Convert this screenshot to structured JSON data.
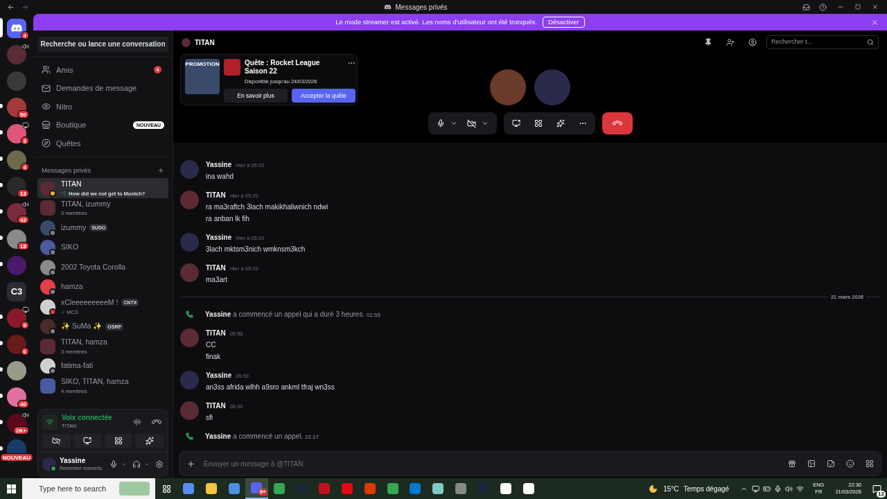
{
  "titlebar": {
    "title": "Messages privés"
  },
  "banner": {
    "text": "Le mode streamer est activé. Les noms d'utilisateur ont été tronqués.",
    "button": "Désactiver"
  },
  "servers": [
    {
      "kind": "home",
      "badge": "4",
      "unread": false,
      "selected": true,
      "speaker": false,
      "monitor": false
    },
    {
      "kind": "avatar",
      "color": "#5a2a35",
      "unread": false,
      "selected": false,
      "speaker": true,
      "monitor": false
    },
    {
      "kind": "avatar",
      "color": "#3a3a3a",
      "unread": false,
      "selected": false,
      "speaker": false,
      "monitor": false
    },
    {
      "kind": "avatar",
      "color": "#a33a3a",
      "badge": "50",
      "unread": true,
      "selected": false,
      "speaker": false,
      "monitor": false
    },
    {
      "kind": "avatar",
      "color": "#e0567a",
      "badge": "3",
      "unread": true,
      "selected": false,
      "speaker": false,
      "monitor": true
    },
    {
      "kind": "avatar",
      "color": "#6b6b4a",
      "badge": "4",
      "unread": true,
      "selected": false,
      "speaker": false,
      "monitor": false
    },
    {
      "kind": "avatar",
      "color": "#2a2a2a",
      "badge": "13",
      "unread": true,
      "selected": false,
      "speaker": false,
      "monitor": false
    },
    {
      "kind": "avatar",
      "color": "#7a2a3a",
      "badge": "42",
      "unread": true,
      "selected": false,
      "speaker": true,
      "monitor": false
    },
    {
      "kind": "avatar",
      "color": "#8a8a8a",
      "badge": "15",
      "unread": true,
      "selected": false,
      "speaker": false,
      "monitor": false
    },
    {
      "kind": "avatar",
      "color": "#4a1a6a",
      "unread": true,
      "selected": false,
      "speaker": false,
      "monitor": false
    },
    {
      "kind": "text",
      "label": "C3",
      "unread": false,
      "selected": false,
      "speaker": false,
      "monitor": false
    },
    {
      "kind": "avatar",
      "color": "#8a1a2a",
      "badge": "9",
      "unread": true,
      "selected": false,
      "speaker": false,
      "monitor": true
    },
    {
      "kind": "avatar",
      "color": "#6a1a1a",
      "badge": "6",
      "unread": true,
      "selected": false,
      "speaker": false,
      "monitor": false
    },
    {
      "kind": "avatar",
      "color": "#9a9a8a",
      "unread": true,
      "selected": false,
      "speaker": false,
      "monitor": false
    },
    {
      "kind": "avatar",
      "color": "#e070a0",
      "badge": "40",
      "unread": true,
      "selected": false,
      "speaker": false,
      "monitor": false
    },
    {
      "kind": "avatar",
      "color": "#5a0a1a",
      "badge": "2K+",
      "unread": true,
      "selected": false,
      "speaker": true,
      "monitor": false
    },
    {
      "kind": "avatar",
      "color": "#1a3a6a",
      "badge": "NOUVEAU",
      "unread": true,
      "selected": false,
      "speaker": false,
      "monitor": false
    }
  ],
  "sidebar": {
    "search": "Recherche ou lance une conversation",
    "nav": [
      {
        "kind": "friends",
        "label": "Amis",
        "badge": "4"
      },
      {
        "kind": "requests",
        "label": "Demandes de message"
      },
      {
        "kind": "nitro",
        "label": "Nitro"
      },
      {
        "kind": "shop",
        "label": "Boutique",
        "tag": "NOUVEAU"
      },
      {
        "kind": "quests",
        "label": "Quêtes"
      }
    ],
    "dm_header": "Messages privés",
    "dms": [
      {
        "name": "TITAN",
        "sub": "How did we not get to Munich?",
        "sub_prefix": "+1",
        "status": {
          "color": "#f0b232"
        },
        "group": false,
        "selected": true,
        "color": "#5a2a35"
      },
      {
        "name": "TITAN, izummy",
        "sub": "3 membres",
        "group": true,
        "selected": false,
        "color": "#5a2a35"
      },
      {
        "name": "izummy",
        "tag": "SUDO",
        "status": {
          "color": "#80848e"
        },
        "group": false,
        "selected": false,
        "color": "#3a4a6a"
      },
      {
        "name": "SIKO",
        "status": {
          "color": "#80848e"
        },
        "group": false,
        "selected": false,
        "color": "#4a5aa0"
      },
      {
        "name": "2002 Toyota Corolla",
        "status": {
          "color": "#80848e"
        },
        "group": false,
        "selected": false,
        "color": "#8a8a8a"
      },
      {
        "name": "hamza",
        "status": {
          "color": "#80848e"
        },
        "group": false,
        "selected": false,
        "color": "#e0404a"
      },
      {
        "name": "xCleeeeeeeeeM !",
        "sub": "MC3",
        "sub_prefix": "♫",
        "tag": "CNTX",
        "status": {
          "color": "#f23f43"
        },
        "group": false,
        "selected": false,
        "color": "#cfcfcf"
      },
      {
        "name": "✨ SuMa ✨",
        "tag": "OSRP",
        "status": {
          "color": "#80848e"
        },
        "group": false,
        "selected": false,
        "color": "#4a2a2a"
      },
      {
        "name": "TITAN, hamza",
        "sub": "3 membres",
        "group": true,
        "selected": false,
        "color": "#5a2a35"
      },
      {
        "name": "fatima-fati",
        "status": {
          "color": "#80848e"
        },
        "group": false,
        "selected": false,
        "color": "#d0d0d0"
      },
      {
        "name": "SIKO, TITAN, hamza",
        "sub": "4 membres",
        "group": true,
        "selected": false,
        "color": "#4a5aa0"
      }
    ],
    "voice": {
      "title": "Voix connectée",
      "channel": "TITAN"
    },
    "user": {
      "name": "Yassine",
      "status": "Remember moments,",
      "presence": {
        "color": "#23a55a"
      }
    }
  },
  "header": {
    "name": "TITAN",
    "search_placeholder": "Rechercher t..."
  },
  "quest": {
    "badge": "PROMOTION",
    "title": "Quête : Rocket League Saison 22",
    "subtitle": "Disponible jusqu'au 24/03/2026",
    "secondary": "En savoir plus",
    "primary": "Accepter la quête"
  },
  "call": {
    "participants": [
      {
        "color": "#6a3a2a"
      },
      {
        "color": "#2a2a4a"
      }
    ]
  },
  "messages": [
    {
      "kind": "message",
      "author": "Yassine",
      "color": "#2a2a4a",
      "time": "Hier à 05:20",
      "lines": [
        "ina wahd"
      ]
    },
    {
      "kind": "message",
      "author": "TITAN",
      "color": "#5a2a35",
      "time": "Hier à 05:20",
      "lines": [
        "ra ma3raftch 3lach makikhaliwnich ndwi",
        "ra anban lk fih"
      ]
    },
    {
      "kind": "message",
      "author": "Yassine",
      "color": "#2a2a4a",
      "time": "Hier à 05:20",
      "lines": [
        "3lach mktsm3nich wmknsm3kch"
      ]
    },
    {
      "kind": "message",
      "author": "TITAN",
      "color": "#5a2a35",
      "time": "Hier à 05:20",
      "lines": [
        "ma3art"
      ]
    },
    {
      "kind": "divider",
      "text": "21 mars 2026"
    },
    {
      "kind": "call",
      "author": "Yassine",
      "text": "a commencé un appel qui a duré 3 heures.",
      "time": "01:55"
    },
    {
      "kind": "message",
      "author": "TITAN",
      "color": "#5a2a35",
      "time": "05:58",
      "lines": [
        "CC",
        "finak"
      ]
    },
    {
      "kind": "message",
      "author": "Yassine",
      "color": "#2a2a4a",
      "time": "05:59",
      "lines": [
        "an3ss afrida wlhh a9sro ankml tfraj wn3ss"
      ]
    },
    {
      "kind": "message",
      "author": "TITAN",
      "color": "#5a2a35",
      "time": "06:00",
      "lines": [
        "sfi"
      ]
    },
    {
      "kind": "call",
      "author": "Yassine",
      "text": "a commencé un appel.",
      "time": "22:17"
    }
  ],
  "composer": {
    "placeholder": "Envoyer un message à @TITAN"
  },
  "taskbar": {
    "search_placeholder": "Type here to search",
    "apps": [
      {
        "kind": "copilot",
        "active": false
      },
      {
        "kind": "folder",
        "active": false
      },
      {
        "kind": "store",
        "active": false
      },
      {
        "kind": "discord",
        "active": true,
        "badge": "9+"
      },
      {
        "kind": "chrome",
        "active": false
      },
      {
        "kind": "steam",
        "active": false
      },
      {
        "kind": "red",
        "active": false
      },
      {
        "kind": "netflix",
        "active": false
      },
      {
        "kind": "office",
        "active": false
      },
      {
        "kind": "chrome",
        "active": false
      },
      {
        "kind": "code",
        "active": false
      },
      {
        "kind": "notes",
        "active": false
      },
      {
        "kind": "clock",
        "active": false
      },
      {
        "kind": "steam",
        "active": false
      },
      {
        "kind": "shield",
        "active": false
      },
      {
        "kind": "gear",
        "active": false
      }
    ],
    "weather": "15°C",
    "weather_text": "Temps dégagé",
    "lang_top": "ENG",
    "lang_bottom": "FR",
    "time": "22:30",
    "date": "21/03/2026",
    "notifications": "12"
  }
}
